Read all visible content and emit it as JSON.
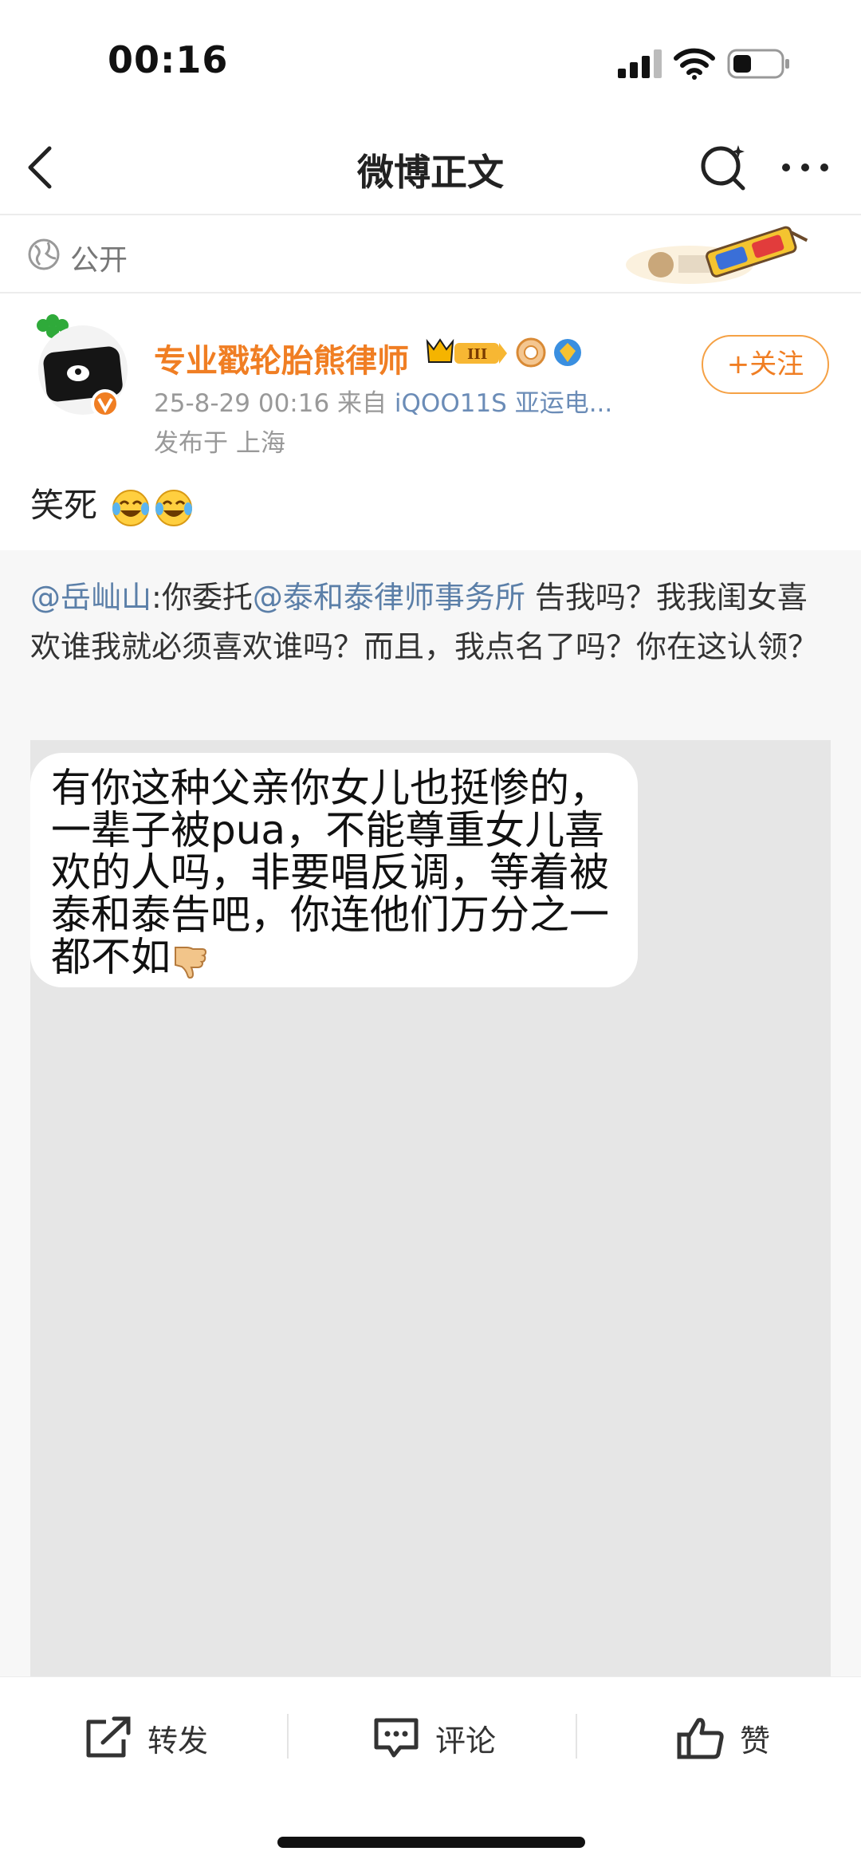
{
  "status_bar": {
    "time": "00:16"
  },
  "nav": {
    "title": "微博正文"
  },
  "visibility": {
    "label": "公开"
  },
  "author": {
    "name": "专业戳轮胎熊律师",
    "vip_level": "III",
    "timestamp": "25-8-29 00:16",
    "source_prefix": "来自",
    "source": "iQOO11S 亚运电...",
    "location": "发布于 上海",
    "follow_label": "+关注"
  },
  "post": {
    "text": "笑死"
  },
  "repost": {
    "mention_1": "@岳屾山",
    "part_1": ":你委托",
    "mention_2": "@泰和泰律师事务所",
    "part_2": " 告我吗？我我闺女喜欢谁我就必须喜欢谁吗？而且，我点名了吗？你在这认领？",
    "image_message": "有你这种父亲你女儿也挺惨的，一辈子被pua，不能尊重女儿喜欢的人吗，非要唱反调，等着被泰和泰告吧，你连他们万分之一都不如"
  },
  "actions": {
    "repost": "转发",
    "comment": "评论",
    "like": "赞"
  },
  "colors": {
    "accent": "#f07e23",
    "link": "#5b7fa8",
    "meta": "#999999"
  }
}
